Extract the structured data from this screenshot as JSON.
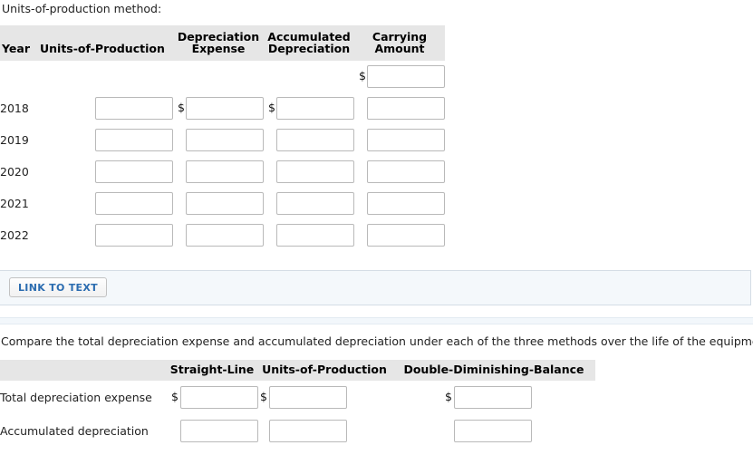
{
  "intro": {
    "text": "Units-of-production method:"
  },
  "units_of_production_table": {
    "headers": {
      "year": "Year",
      "units": "Units-of-Production",
      "depreciation_expense_line1": "Depreciation",
      "depreciation_expense_line2": "Expense",
      "accumulated_depreciation_line1": "Accumulated",
      "accumulated_depreciation_line2": "Depreciation",
      "carrying_amount_line1": "Carrying",
      "carrying_amount_line2": "Amount"
    },
    "currency_symbol": "$",
    "opening_row": {
      "year": "",
      "units": "",
      "depreciation_expense": "",
      "accumulated_depreciation": "",
      "carrying_amount": ""
    },
    "rows": [
      {
        "year": "2018",
        "units": "",
        "depreciation_expense": "",
        "accumulated_depreciation": "",
        "carrying_amount": ""
      },
      {
        "year": "2019",
        "units": "",
        "depreciation_expense": "",
        "accumulated_depreciation": "",
        "carrying_amount": ""
      },
      {
        "year": "2020",
        "units": "",
        "depreciation_expense": "",
        "accumulated_depreciation": "",
        "carrying_amount": ""
      },
      {
        "year": "2021",
        "units": "",
        "depreciation_expense": "",
        "accumulated_depreciation": "",
        "carrying_amount": ""
      },
      {
        "year": "2022",
        "units": "",
        "depreciation_expense": "",
        "accumulated_depreciation": "",
        "carrying_amount": ""
      }
    ]
  },
  "link_panel": {
    "button_label": "LINK TO TEXT"
  },
  "compare_prompt": {
    "text": "Compare the total depreciation expense and accumulated depreciation under each of the three methods over the life of the equipment.",
    "trailing_mark": "("
  },
  "compare_table": {
    "headers": {
      "label": "",
      "straight_line": "Straight-Line",
      "units_of_production": "Units-of-Production",
      "double_diminishing_balance": "Double-Diminishing-Balance"
    },
    "currency_symbol": "$",
    "rows": [
      {
        "label": "Total depreciation expense",
        "show_currency": true,
        "straight_line": "",
        "units_of_production": "",
        "double_diminishing_balance": ""
      },
      {
        "label": "Accumulated depreciation",
        "show_currency": false,
        "straight_line": "",
        "units_of_production": "",
        "double_diminishing_balance": ""
      }
    ]
  },
  "colors": {
    "header_bg": "#e6e6e6",
    "panel_bg": "#f4f8fb",
    "link_text": "#2b6cb0",
    "accent_red": "#d0241b",
    "input_border": "#b9b9b9"
  }
}
